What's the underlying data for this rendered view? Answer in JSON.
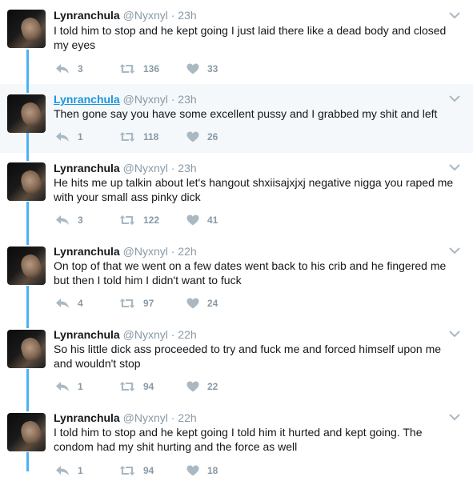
{
  "tweets": [
    {
      "name": "Lynranchula",
      "handle": "@Nyxnyl",
      "time": "23h",
      "text": "I told him to stop and he kept going I just laid there like a dead body and closed my eyes",
      "replies": "3",
      "retweets": "136",
      "likes": "33",
      "highlighted": false
    },
    {
      "name": "Lynranchula",
      "handle": "@Nyxnyl",
      "time": "23h",
      "text": "Then gone say you have some excellent pussy and I grabbed my shit and left",
      "replies": "1",
      "retweets": "118",
      "likes": "26",
      "highlighted": true
    },
    {
      "name": "Lynranchula",
      "handle": "@Nyxnyl",
      "time": "23h",
      "text": "He hits me up talkin about let's hangout shxiisajxjxj negative nigga you raped me with your small ass pinky dick",
      "replies": "3",
      "retweets": "122",
      "likes": "41",
      "highlighted": false
    },
    {
      "name": "Lynranchula",
      "handle": "@Nyxnyl",
      "time": "22h",
      "text": "On top of that we went on a few dates went back to his crib and he fingered me but then I told him I didn't want to fuck",
      "replies": "4",
      "retweets": "97",
      "likes": "24",
      "highlighted": false
    },
    {
      "name": "Lynranchula",
      "handle": "@Nyxnyl",
      "time": "22h",
      "text": "So his little dick ass proceeded to try and fuck me and forced himself upon me and wouldn't stop",
      "replies": "1",
      "retweets": "94",
      "likes": "22",
      "highlighted": false
    },
    {
      "name": "Lynranchula",
      "handle": "@Nyxnyl",
      "time": "22h",
      "text": "I told him to stop and he kept going I told him it hurted and kept going. The condom had my shit hurting and the force as well",
      "replies": "1",
      "retweets": "94",
      "likes": "18",
      "highlighted": false
    }
  ],
  "sep": " · ",
  "colors": {
    "thread_line": "#4ab3f4",
    "link": "#1b95e0",
    "meta": "#8899a6",
    "highlight_bg": "#f5f8fa"
  }
}
